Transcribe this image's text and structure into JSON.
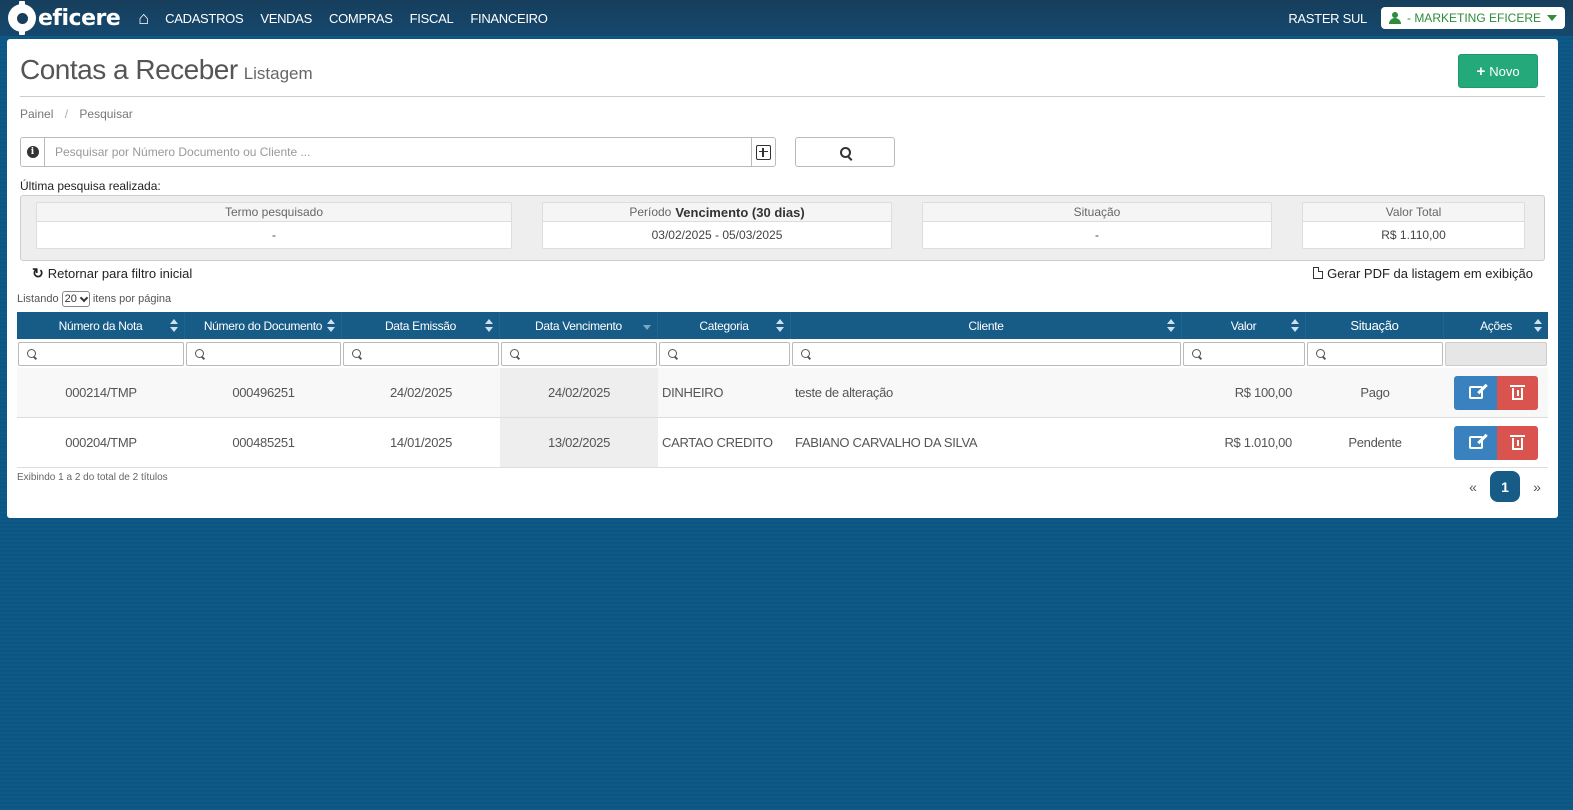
{
  "nav": {
    "brand": "eficere",
    "menu": [
      "CADASTROS",
      "VENDAS",
      "COMPRAS",
      "FISCAL",
      "FINANCEIRO"
    ],
    "company": "RASTER SUL",
    "user": "- MARKETING EFICERE"
  },
  "page": {
    "title": "Contas a Receber",
    "subtitle": "Listagem",
    "new_button": "Novo",
    "breadcrumb": [
      "Painel",
      "Pesquisar"
    ]
  },
  "search": {
    "placeholder": "Pesquisar por Número Documento ou Cliente ..."
  },
  "last_search": {
    "label": "Última pesquisa realizada:",
    "term_label": "Termo pesquisado",
    "term_value": "-",
    "period_prefix": "Período",
    "period_label": "Vencimento (30 dias)",
    "period_value": "03/02/2025 - 05/03/2025",
    "status_label": "Situação",
    "status_value": "-",
    "total_label": "Valor Total",
    "total_value": "R$ 1.110,00"
  },
  "links": {
    "reset": "Retornar para filtro inicial",
    "pdf": "Gerar PDF da listagem em exibição"
  },
  "per_page": {
    "prefix": "Listando",
    "value": "20",
    "suffix": "itens por página"
  },
  "table": {
    "columns": [
      "Número da Nota",
      "Número do Documento",
      "Data Emissão",
      "Data Vencimento",
      "Categoria",
      "Cliente",
      "Valor",
      "Situação",
      "Ações"
    ],
    "rows": [
      [
        "000214/TMP",
        "000496251",
        "24/02/2025",
        "24/02/2025",
        "DINHEIRO",
        "teste de alteração",
        "R$ 100,00",
        "Pago"
      ],
      [
        "000204/TMP",
        "000485251",
        "14/01/2025",
        "13/02/2025",
        "CARTAO CREDITO",
        "FABIANO CARVALHO DA SILVA",
        "R$ 1.010,00",
        "Pendente"
      ]
    ]
  },
  "footer": {
    "info": "Exibindo 1 a 2 do total de 2 títulos",
    "current_page": "1",
    "prev": "«",
    "next": "»"
  },
  "colors": {
    "navbar": "#173e5c",
    "header": "#175b87",
    "new_button": "#24a97a",
    "edit": "#3a81bf",
    "delete": "#d9534f",
    "user_text": "#2e8b3a"
  }
}
